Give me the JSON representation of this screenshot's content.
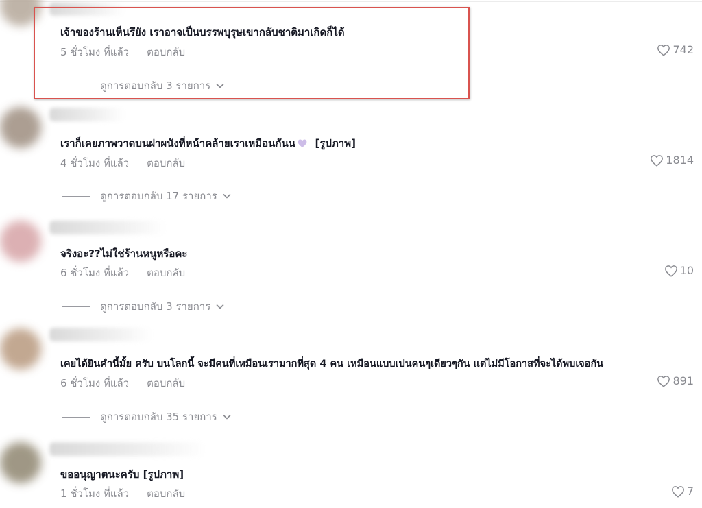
{
  "comments": [
    {
      "text": "เจ้าของร้านเห็นรึยัง เราอาจเป็นบรรพบุรุษเขากลับชาติมาเกิดก็ได้",
      "time": "5 ชั่วโมง ที่แล้ว",
      "reply": "ตอบกลับ",
      "likes": "742",
      "view_replies": "ดูการตอบกลับ 3 รายการ"
    },
    {
      "text": "เราก็เคยภาพวาดบนฝาผนังที่หน้าคล้ายเราเหมือนกันน",
      "text_suffix": "[รูปภาพ]",
      "time": "4 ชั่วโมง ที่แล้ว",
      "reply": "ตอบกลับ",
      "likes": "1814",
      "view_replies": "ดูการตอบกลับ 17 รายการ"
    },
    {
      "text": "จริงอะ??ไม่ใช่ร้านหนูหรือคะ",
      "time": "6 ชั่วโมง ที่แล้ว",
      "reply": "ตอบกลับ",
      "likes": "10",
      "view_replies": "ดูการตอบกลับ 3 รายการ"
    },
    {
      "text": "เคยได้ยินคำนี้มั้ย ครับ บนโลกนี้ จะมีคนที่เหมือนเรามากที่สุด 4 คน เหมือนแบบเปนคนๆเดียวๆกัน แต่ไม่มีโอกาสที่จะได้พบเจอกัน",
      "time": "6 ชั่วโมง ที่แล้ว",
      "reply": "ตอบกลับ",
      "likes": "891",
      "view_replies": "ดูการตอบกลับ 35 รายการ"
    },
    {
      "text": "ขออนุญาตนะครับ [รูปภาพ]",
      "time": "1 ชั่วโมง ที่แล้ว",
      "reply": "ตอบกลับ",
      "likes": "7"
    }
  ],
  "colors": {
    "highlight": "#d9534f",
    "muted": "#8a8b91",
    "text": "#161823"
  }
}
